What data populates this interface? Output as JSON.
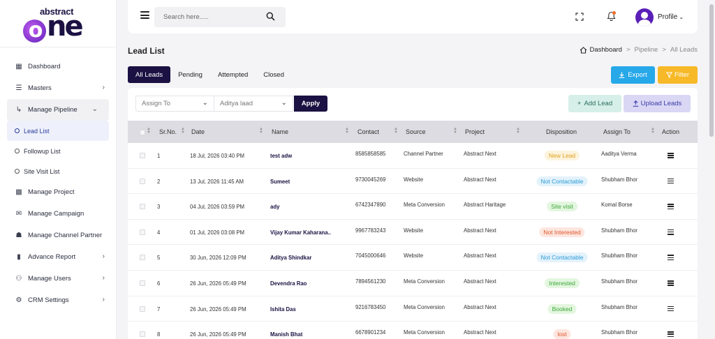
{
  "brand": {
    "word": "abstract",
    "one_o": "o",
    "one_rest": "ne"
  },
  "sidebar": {
    "items": [
      {
        "label": "Dashboard",
        "icon": "dashboard-icon",
        "chevron": false
      },
      {
        "label": "Masters",
        "icon": "list-icon",
        "chevron": true
      },
      {
        "label": "Manage Pipeline",
        "icon": "pipeline-icon",
        "chevron": true,
        "open": true
      },
      {
        "label": "Manage Project",
        "icon": "building-icon",
        "chevron": false
      },
      {
        "label": "Manage Campaign",
        "icon": "megaphone-icon",
        "chevron": false
      },
      {
        "label": "Manage Channel Partner",
        "icon": "handshake-icon",
        "chevron": false
      },
      {
        "label": "Advance Report",
        "icon": "bar-chart-icon",
        "chevron": true
      },
      {
        "label": "Manage Users",
        "icon": "users-icon",
        "chevron": true
      },
      {
        "label": "CRM Settings",
        "icon": "gear-icon",
        "chevron": true
      }
    ],
    "subitems": [
      {
        "label": "Lead List",
        "active": true
      },
      {
        "label": "Followup List",
        "active": false
      },
      {
        "label": "Site Visit List",
        "active": false
      }
    ]
  },
  "topbar": {
    "search_placeholder": "Search here.....",
    "profile_label": "Profile"
  },
  "page": {
    "title": "Lead List",
    "breadcrumb": [
      "Dashboard",
      "Pipeline",
      "All Leads"
    ]
  },
  "tabs": [
    "All Leads",
    "Pending",
    "Attempted",
    "Closed"
  ],
  "actions": {
    "export": "Export",
    "filter": "Filter",
    "add_lead": "Add Lead",
    "upload_leads": "Upload Leads",
    "apply": "Apply"
  },
  "filters": {
    "assign_to": "Assign To",
    "user": "Aditya laad"
  },
  "table": {
    "headers": [
      "Sr.No.",
      "Date",
      "Name",
      "Contact",
      "Source",
      "Project",
      "Disposition",
      "Assign To",
      "Action"
    ],
    "rows": [
      {
        "sr": "1",
        "date": "18 Jul, 2026 03:40 PM",
        "name": "test adw",
        "contact": "8585858585",
        "source": "Channel Partner",
        "project": "Abstract Next",
        "disposition": "New Lead",
        "assign": "Aaditya Verma"
      },
      {
        "sr": "2",
        "date": "13 Jul, 2026 11:45 AM",
        "name": "Sumeet",
        "contact": "9730045269",
        "source": "Website",
        "project": "Abstract Next",
        "disposition": "Not Contactable",
        "assign": "Shubham Bhor"
      },
      {
        "sr": "3",
        "date": "04 Jul, 2026 03:59 PM",
        "name": "ady",
        "contact": "6742347890",
        "source": "Meta Conversion",
        "project": "Abstract Haritage",
        "disposition": "Site visit",
        "assign": "Komal Borse"
      },
      {
        "sr": "4",
        "date": "01 Jul, 2026 03:08 PM",
        "name": "Vijay Kumar Kaharana..",
        "contact": "9967783243",
        "source": "Website",
        "project": "Abstract Next",
        "disposition": "Not Interested",
        "assign": "Shubham Bhor"
      },
      {
        "sr": "5",
        "date": "30 Jun, 2026 12:09 PM",
        "name": "Aditya Shindkar",
        "contact": "7045000646",
        "source": "Website",
        "project": "Abstract Next",
        "disposition": "Not Contactable",
        "assign": "Shubham Bhor"
      },
      {
        "sr": "6",
        "date": "26 Jun, 2026 05:49 PM",
        "name": "Devendra Rao",
        "contact": "7894561230",
        "source": "Meta Conversion",
        "project": "Abstract Next",
        "disposition": "Interested",
        "assign": "Shubham Bhor"
      },
      {
        "sr": "7",
        "date": "26 Jun, 2026 05:49 PM",
        "name": "Ishita Das",
        "contact": "9216783450",
        "source": "Meta Conversion",
        "project": "Abstract Next",
        "disposition": "Booked",
        "assign": "Shubham Bhor"
      },
      {
        "sr": "8",
        "date": "26 Jun, 2026 05:49 PM",
        "name": "Manish Bhat",
        "contact": "6678901234",
        "source": "Meta Conversion",
        "project": "Abstract Next",
        "disposition": "lost",
        "assign": "Shubham Bhor"
      }
    ]
  },
  "disposition_colors": {
    "New Lead": {
      "bg": "#fdf3dc",
      "fg": "#e0a020"
    },
    "Not Contactable": {
      "bg": "#e3f2fb",
      "fg": "#2a9ad8"
    },
    "Site visit": {
      "bg": "#e3f6df",
      "fg": "#3ca838"
    },
    "Not Interested": {
      "bg": "#fde6df",
      "fg": "#e0552a"
    },
    "Interested": {
      "bg": "#e3f6df",
      "fg": "#3ca838"
    },
    "Booked": {
      "bg": "#e3f6df",
      "fg": "#3ca838"
    },
    "lost": {
      "bg": "#fde6df",
      "fg": "#e0552a"
    }
  }
}
